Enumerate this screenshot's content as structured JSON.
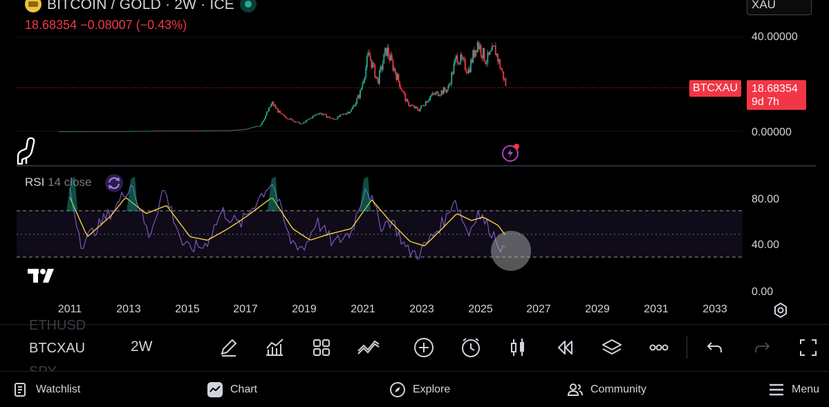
{
  "header": {
    "title": "BITCOIN / GOLD · 2W · ICE",
    "price_line": "18.68354  −0.08007 (−0.43%)"
  },
  "currency_box": "XAU",
  "price_axis": {
    "labels": [
      "40.00000",
      "0.00000"
    ]
  },
  "last_price_tag": {
    "symbol": "BTCXAU",
    "price": "18.68354",
    "countdown": "9d 7h"
  },
  "rsi": {
    "name": "RSI",
    "params": "14 close",
    "axis_labels": [
      "80.00",
      "40.00",
      "0.00"
    ]
  },
  "time_axis": {
    "labels": [
      "2011",
      "2013",
      "2015",
      "2017",
      "2019",
      "2021",
      "2023",
      "2025",
      "2027",
      "2029",
      "2031",
      "2033"
    ]
  },
  "symbol_bar": {
    "prev_symbol": "ETHUSD",
    "current_symbol": "BTCXAU",
    "next_symbol": "SPY",
    "interval": "2W"
  },
  "toolbar": [
    "pencil-icon",
    "indicators-icon",
    "layouts-icon",
    "compare-icon",
    "add-icon",
    "alert-icon",
    "candles-icon",
    "replay-icon",
    "layers-icon",
    "more-icon",
    "undo-icon",
    "redo-icon",
    "fullscreen-icon"
  ],
  "bottom_nav": {
    "watchlist": "Watchlist",
    "chart": "Chart",
    "explore": "Explore",
    "community": "Community",
    "menu": "Menu"
  },
  "colors": {
    "down": "#f23645",
    "up": "#22ab94",
    "rsi": "#7e57c2",
    "rsi_ma": "#f2d43c",
    "background": "#000000"
  },
  "chart_data": {
    "type": "candlestick",
    "symbol": "BTCXAU",
    "interval": "2W",
    "x_range": [
      "2010",
      "2034"
    ],
    "price_range": [
      -5,
      42
    ],
    "last_price": 18.68354,
    "price_series": [
      {
        "x": 2010.5,
        "close": 0.0
      },
      {
        "x": 2013.0,
        "close": 0.05
      },
      {
        "x": 2014.0,
        "close": 0.2
      },
      {
        "x": 2016.5,
        "close": 0.4
      },
      {
        "x": 2017.0,
        "close": 0.9
      },
      {
        "x": 2017.5,
        "close": 2.5
      },
      {
        "x": 2017.9,
        "close": 12.0
      },
      {
        "x": 2018.2,
        "close": 7.0
      },
      {
        "x": 2018.9,
        "close": 3.0
      },
      {
        "x": 2019.5,
        "close": 8.0
      },
      {
        "x": 2020.0,
        "close": 5.0
      },
      {
        "x": 2020.6,
        "close": 9.0
      },
      {
        "x": 2020.9,
        "close": 16.0
      },
      {
        "x": 2021.2,
        "close": 33.0
      },
      {
        "x": 2021.5,
        "close": 21.0
      },
      {
        "x": 2021.8,
        "close": 35.0
      },
      {
        "x": 2022.2,
        "close": 22.0
      },
      {
        "x": 2022.5,
        "close": 12.0
      },
      {
        "x": 2022.9,
        "close": 9.0
      },
      {
        "x": 2023.3,
        "close": 15.0
      },
      {
        "x": 2023.9,
        "close": 18.0
      },
      {
        "x": 2024.2,
        "close": 32.0
      },
      {
        "x": 2024.6,
        "close": 26.0
      },
      {
        "x": 2024.9,
        "close": 38.0
      },
      {
        "x": 2025.2,
        "close": 30.0
      },
      {
        "x": 2025.5,
        "close": 35.0
      },
      {
        "x": 2025.9,
        "close": 18.7
      }
    ],
    "rsi_range": [
      0,
      105
    ],
    "rsi_bands": [
      70,
      50,
      30
    ],
    "rsi_series": [
      {
        "x": 2011.0,
        "rsi": 88
      },
      {
        "x": 2011.4,
        "rsi": 42
      },
      {
        "x": 2012.0,
        "rsi": 58
      },
      {
        "x": 2012.6,
        "rsi": 75
      },
      {
        "x": 2013.1,
        "rsi": 95
      },
      {
        "x": 2013.7,
        "rsi": 48
      },
      {
        "x": 2014.2,
        "rsi": 90
      },
      {
        "x": 2014.9,
        "rsi": 38
      },
      {
        "x": 2015.6,
        "rsi": 40
      },
      {
        "x": 2016.2,
        "rsi": 70
      },
      {
        "x": 2016.8,
        "rsi": 58
      },
      {
        "x": 2017.4,
        "rsi": 80
      },
      {
        "x": 2017.9,
        "rsi": 96
      },
      {
        "x": 2018.5,
        "rsi": 45
      },
      {
        "x": 2019.0,
        "rsi": 38
      },
      {
        "x": 2019.4,
        "rsi": 62
      },
      {
        "x": 2020.0,
        "rsi": 42
      },
      {
        "x": 2020.6,
        "rsi": 52
      },
      {
        "x": 2021.1,
        "rsi": 93
      },
      {
        "x": 2021.6,
        "rsi": 58
      },
      {
        "x": 2022.0,
        "rsi": 62
      },
      {
        "x": 2022.5,
        "rsi": 36
      },
      {
        "x": 2022.9,
        "rsi": 33
      },
      {
        "x": 2023.4,
        "rsi": 50
      },
      {
        "x": 2023.9,
        "rsi": 66
      },
      {
        "x": 2024.1,
        "rsi": 83
      },
      {
        "x": 2024.6,
        "rsi": 50
      },
      {
        "x": 2024.9,
        "rsi": 70
      },
      {
        "x": 2025.4,
        "rsi": 52
      },
      {
        "x": 2025.7,
        "rsi": 40
      },
      {
        "x": 2025.9,
        "rsi": 31
      }
    ],
    "rsi_ma_series": [
      {
        "x": 2011.0,
        "rsi": 82
      },
      {
        "x": 2011.6,
        "rsi": 48
      },
      {
        "x": 2012.4,
        "rsi": 66
      },
      {
        "x": 2012.9,
        "rsi": 82
      },
      {
        "x": 2013.6,
        "rsi": 68
      },
      {
        "x": 2014.3,
        "rsi": 75
      },
      {
        "x": 2015.1,
        "rsi": 48
      },
      {
        "x": 2015.7,
        "rsi": 45
      },
      {
        "x": 2016.4,
        "rsi": 55
      },
      {
        "x": 2017.0,
        "rsi": 65
      },
      {
        "x": 2017.9,
        "rsi": 82
      },
      {
        "x": 2018.6,
        "rsi": 55
      },
      {
        "x": 2019.2,
        "rsi": 45
      },
      {
        "x": 2019.8,
        "rsi": 50
      },
      {
        "x": 2020.6,
        "rsi": 55
      },
      {
        "x": 2021.3,
        "rsi": 80
      },
      {
        "x": 2021.9,
        "rsi": 62
      },
      {
        "x": 2022.6,
        "rsi": 44
      },
      {
        "x": 2023.1,
        "rsi": 40
      },
      {
        "x": 2023.7,
        "rsi": 55
      },
      {
        "x": 2024.2,
        "rsi": 68
      },
      {
        "x": 2024.7,
        "rsi": 62
      },
      {
        "x": 2025.1,
        "rsi": 65
      },
      {
        "x": 2025.6,
        "rsi": 58
      },
      {
        "x": 2025.9,
        "rsi": 48
      }
    ]
  }
}
